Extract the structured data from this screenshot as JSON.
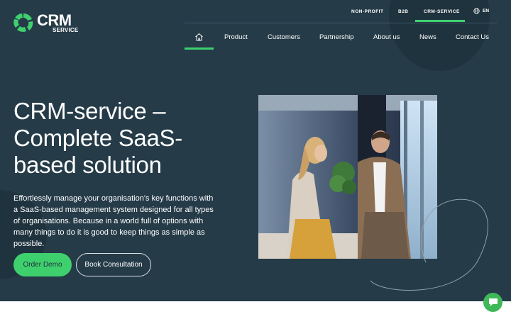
{
  "brand": {
    "title": "CRM",
    "subtitle": "SERVICE"
  },
  "top_nav": {
    "items": [
      "NON-PROFIT",
      "B2B",
      "CRM-SERVICE"
    ],
    "active": "CRM-SERVICE",
    "language": "EN"
  },
  "main_nav": {
    "items": [
      "Product",
      "Customers",
      "Partnership",
      "About us",
      "News",
      "Contact Us"
    ],
    "active": "home"
  },
  "hero": {
    "headline_lines": [
      "CRM-service –",
      "Complete SaaS-",
      "based solution"
    ],
    "lead": "Effortlessly manage your organisation's key functions with a SaaS-based management system designed for all types of organisations. Because in a world full of options with many things to do it is good to keep things as simple as possible.",
    "primary_button": "Order Demo",
    "secondary_button": "Book Consultation"
  },
  "colors": {
    "background": "#253b48",
    "accent": "#3fd06e",
    "dark_circle": "#1f333e"
  },
  "icons": {
    "home": "home-icon",
    "language": "globe-icon",
    "chat": "chat-icon"
  }
}
